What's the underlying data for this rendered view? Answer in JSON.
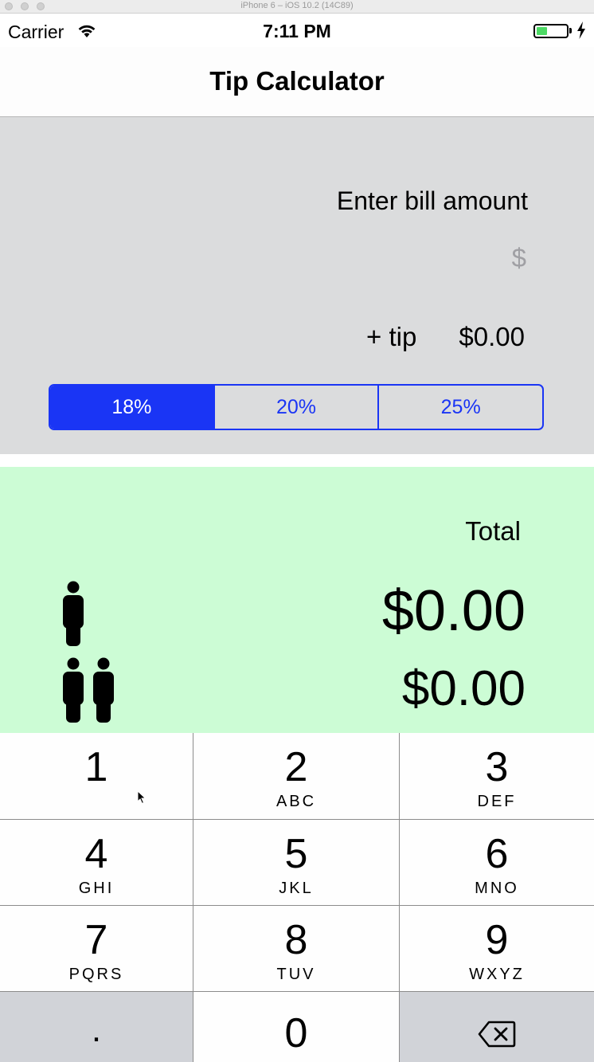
{
  "simulator": {
    "title": "iPhone 6 – iOS 10.2 (14C89)"
  },
  "status_bar": {
    "carrier": "Carrier",
    "time": "7:11 PM"
  },
  "nav": {
    "title": "Tip Calculator"
  },
  "bill": {
    "prompt": "Enter bill amount",
    "placeholder": "$",
    "tip_label": "+ tip",
    "tip_value": "$0.00"
  },
  "tip_options": [
    {
      "label": "18%",
      "selected": true
    },
    {
      "label": "20%",
      "selected": false
    },
    {
      "label": "25%",
      "selected": false
    }
  ],
  "totals": {
    "label": "Total",
    "one_person": "$0.00",
    "two_people": "$0.00"
  },
  "keypad": {
    "keys": [
      {
        "digit": "1",
        "letters": ""
      },
      {
        "digit": "2",
        "letters": "ABC"
      },
      {
        "digit": "3",
        "letters": "DEF"
      },
      {
        "digit": "4",
        "letters": "GHI"
      },
      {
        "digit": "5",
        "letters": "JKL"
      },
      {
        "digit": "6",
        "letters": "MNO"
      },
      {
        "digit": "7",
        "letters": "PQRS"
      },
      {
        "digit": "8",
        "letters": "TUV"
      },
      {
        "digit": "9",
        "letters": "WXYZ"
      },
      {
        "digit": "0",
        "letters": ""
      }
    ],
    "decimal": ".",
    "delete_icon": "backspace-icon"
  },
  "colors": {
    "accent": "#1a35f5",
    "input_panel": "#dbdcdd",
    "totals_panel": "#ccfcd5",
    "battery": "#4cd964"
  }
}
